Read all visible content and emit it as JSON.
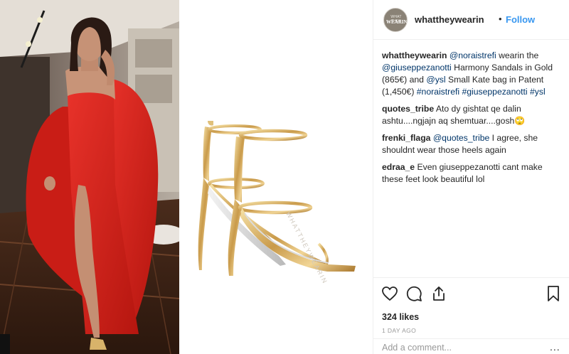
{
  "post": {
    "images": [
      {
        "name": "photo-woman-red-gown"
      },
      {
        "name": "photo-gold-sandals",
        "watermark": "WHATTHEYWEARIN"
      }
    ]
  },
  "header": {
    "avatar_text_top": "WHAT THEY",
    "avatar_text_main": "WEARIN",
    "username": "whattheywearin",
    "separator": "•",
    "follow_label": "Follow"
  },
  "caption": {
    "user": "whattheywearin",
    "mention1": "@noraistrefi",
    "text1": " wearin the ",
    "mention2": "@giuseppezanotti",
    "text2": " Harmony Sandals in Gold (865€) and ",
    "mention3": "@ysl",
    "text3": " Small Kate bag in Patent (1,450€) ",
    "tag1": "#noraistrefi",
    "tag2": "#giuseppezanotti",
    "tag3": "#ysl"
  },
  "comments": [
    {
      "user": "quotes_tribe",
      "text": "Ato dy gishtat qe dalin ashtu....ngjajn aq shemtuar....gosh🙄"
    },
    {
      "user": "frenki_flaga",
      "mention": "@quotes_tribe",
      "text": " I agree, she shouldnt wear those heels again"
    },
    {
      "user": "edraa_e",
      "text": "Even giuseppezanotti cant make these feet look beautiful lol"
    }
  ],
  "actions": {
    "like_icon": "heart-icon",
    "comment_icon": "comment-icon",
    "share_icon": "share-icon",
    "save_icon": "bookmark-icon"
  },
  "likes": "324 likes",
  "timestamp": "1 DAY AGO",
  "add_comment": {
    "placeholder": "Add a comment...",
    "more": "..."
  },
  "colors": {
    "link": "#003569",
    "follow": "#3897f0",
    "muted": "#999999",
    "border": "#efefef"
  }
}
